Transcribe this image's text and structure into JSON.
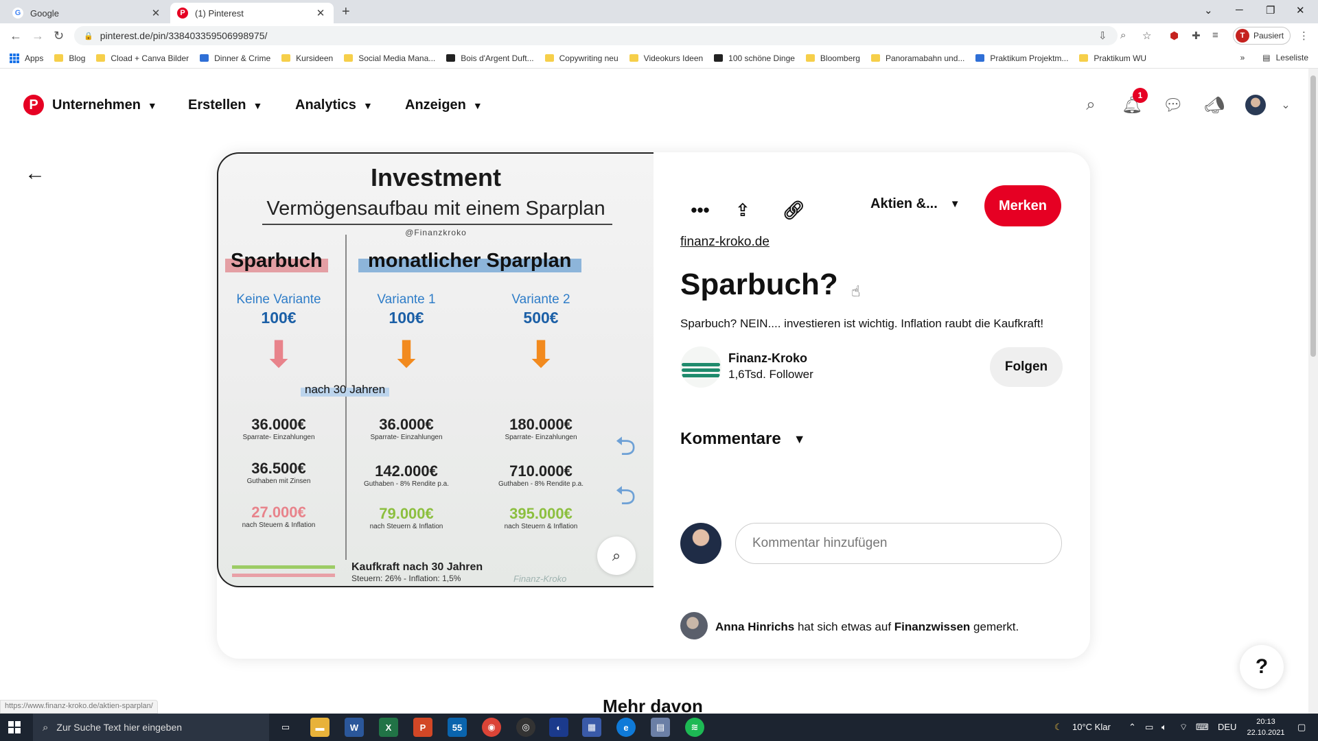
{
  "browser": {
    "tabs": [
      {
        "title": "Google",
        "favicon": "google-icon",
        "active": false
      },
      {
        "title": "(1) Pinterest",
        "favicon": "pinterest-icon",
        "active": true
      }
    ],
    "url": "pinterest.de/pin/338403359506998975/",
    "profile_label": "Pausiert",
    "profile_initial": "T",
    "bookmarks": [
      {
        "label": "Apps",
        "icon": "apps-grid-icon"
      },
      {
        "label": "Blog",
        "icon": "folder-icon"
      },
      {
        "label": "Cload + Canva Bilder",
        "icon": "folder-icon"
      },
      {
        "label": "Dinner & Crime",
        "icon": "site-icon"
      },
      {
        "label": "Kursideen",
        "icon": "folder-icon"
      },
      {
        "label": "Social Media Mana...",
        "icon": "folder-icon"
      },
      {
        "label": "Bois d'Argent Duft...",
        "icon": "site-icon"
      },
      {
        "label": "Copywriting neu",
        "icon": "folder-icon"
      },
      {
        "label": "Videokurs Ideen",
        "icon": "folder-icon"
      },
      {
        "label": "100 schöne Dinge",
        "icon": "site-icon"
      },
      {
        "label": "Bloomberg",
        "icon": "folder-icon"
      },
      {
        "label": "Panoramabahn und...",
        "icon": "folder-icon"
      },
      {
        "label": "Praktikum Projektm...",
        "icon": "site-icon"
      },
      {
        "label": "Praktikum WU",
        "icon": "folder-icon"
      }
    ],
    "reading_list": "Leseliste",
    "status_url": "https://www.finanz-kroko.de/aktien-sparplan/"
  },
  "header": {
    "nav": [
      {
        "label": "Unternehmen"
      },
      {
        "label": "Erstellen"
      },
      {
        "label": "Analytics"
      },
      {
        "label": "Anzeigen"
      }
    ],
    "notification_count": "1",
    "brand_color": "#e60023"
  },
  "pin_image": {
    "title": "Investment",
    "subtitle": "Vermögensaufbau mit einem Sparplan",
    "handle": "@Finanzkroko",
    "col_left": "Sparbuch",
    "col_right": "monatlicher Sparplan",
    "variants": [
      {
        "label": "Keine Variante",
        "amount": "100€",
        "row1": "36.000€",
        "row1_sub": "Sparrate- Einzahlungen",
        "row2": "36.500€",
        "row2_sub": "Guthaben mit Zinsen",
        "row3": "27.000€",
        "row3_sub": "nach Steuern & Inflation",
        "row3_color": "#e8838b",
        "arrow_color": "#e8838b"
      },
      {
        "label": "Variante 1",
        "amount": "100€",
        "row1": "36.000€",
        "row1_sub": "Sparrate- Einzahlungen",
        "row2": "142.000€",
        "row2_sub": "Guthaben - 8% Rendite p.a.",
        "row3": "79.000€",
        "row3_sub": "nach Steuern & Inflation",
        "row3_color": "#8cbf3f",
        "arrow_color": "#f28a1e"
      },
      {
        "label": "Variante 2",
        "amount": "500€",
        "row1": "180.000€",
        "row1_sub": "Sparrate- Einzahlungen",
        "row2": "710.000€",
        "row2_sub": "Guthaben - 8% Rendite p.a.",
        "row3": "395.000€",
        "row3_sub": "nach Steuern & Inflation",
        "row3_color": "#8cbf3f",
        "arrow_color": "#f28a1e"
      }
    ],
    "years_label": "nach 30 Jahren",
    "footer_title": "Kaufkraft nach 30 Jahren",
    "footer_sub": "Steuern: 26% - Inflation: 1,5%",
    "watermark": "Finanz-Kroko"
  },
  "pin": {
    "board": "Aktien &...",
    "save_label": "Merken",
    "source": "finanz-kroko.de",
    "title": "Sparbuch?",
    "description": "Sparbuch? NEIN.... investieren ist wichtig. Inflation raubt die Kaufkraft!",
    "creator_name": "Finanz-Kroko",
    "creator_followers": "1,6Tsd. Follower",
    "follow_label": "Folgen",
    "comments_label": "Kommentare",
    "comment_placeholder": "Kommentar hinzufügen",
    "activity": {
      "user": "Anna Hinrichs",
      "middle": " hat sich etwas auf ",
      "board": "Finanzwissen",
      "end": " gemerkt."
    }
  },
  "more_label": "Mehr davon",
  "help_label": "?",
  "taskbar": {
    "search_placeholder": "Zur Suche Text hier eingeben",
    "mail_count": "55",
    "weather": "10°C  Klar",
    "language": "DEU",
    "time": "20:13",
    "date": "22.10.2021"
  }
}
